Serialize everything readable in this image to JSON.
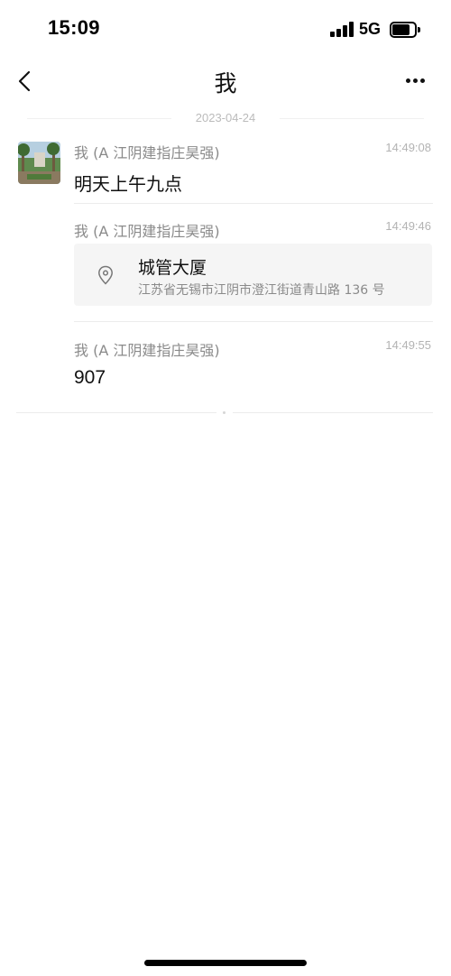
{
  "status_bar": {
    "time": "15:09",
    "network": "5G",
    "signal_bars": 4,
    "battery_level": 0.8
  },
  "nav": {
    "title": "我",
    "back_icon": "chevron-left-icon",
    "more_icon": "more-horizontal-icon"
  },
  "date_divider": "2023-04-24",
  "messages": [
    {
      "sender": "我 (A 江阴建指庄昊强)",
      "time": "14:49:08",
      "type": "text",
      "text": "明天上午九点"
    },
    {
      "sender": "我 (A 江阴建指庄昊强)",
      "time": "14:49:46",
      "type": "location",
      "location": {
        "name": "城管大厦",
        "address": "江苏省无锡市江阴市澄江街道青山路 136 号",
        "icon": "location-pin-icon"
      }
    },
    {
      "sender": "我 (A 江阴建指庄昊强)",
      "time": "14:49:55",
      "type": "text",
      "text": "907"
    }
  ],
  "colors": {
    "background": "#ffffff",
    "text_primary": "#111111",
    "text_secondary": "#8a8a8a",
    "card_background": "#f5f5f5"
  }
}
